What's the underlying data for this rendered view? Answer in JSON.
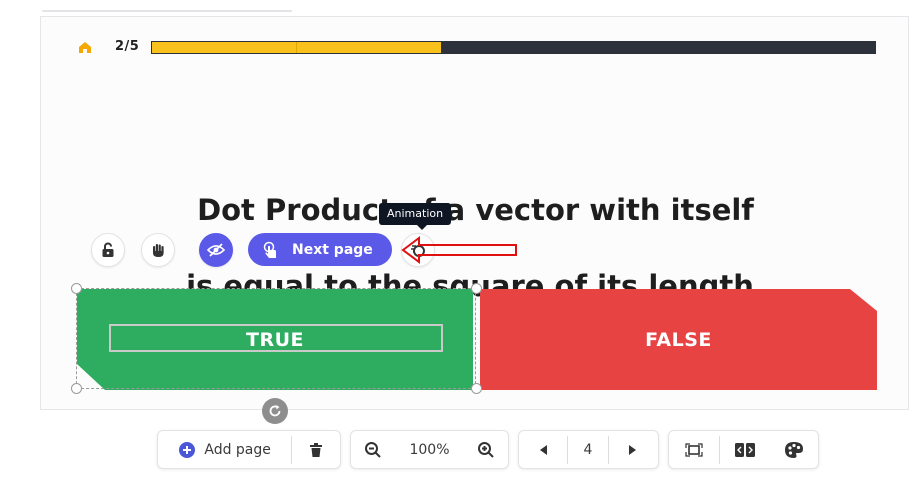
{
  "progress": {
    "label": "2/5",
    "fraction": 0.4,
    "fill_color": "#f9c11b",
    "track_color": "#2d313c"
  },
  "question": {
    "line1": "Dot Product of a vector with itself",
    "line2": "is equal to the square of its length."
  },
  "tooltip": {
    "text": "Animation"
  },
  "element_toolbar": {
    "lock_icon": "lock-icon",
    "hand_icon": "hand-icon",
    "visibility_icon": "eye-off-icon",
    "next_page_label": "Next page",
    "animation_icon": "animation-icon"
  },
  "answers": [
    {
      "label": "TRUE",
      "color": "#2eac60"
    },
    {
      "label": "FALSE",
      "color": "#e84343"
    }
  ],
  "bottom_toolbar": {
    "add_page_label": "Add page",
    "zoom_level": "100%",
    "page_number": "4"
  },
  "colors": {
    "accent": "#5b59e8",
    "annotation": "#e01010"
  }
}
